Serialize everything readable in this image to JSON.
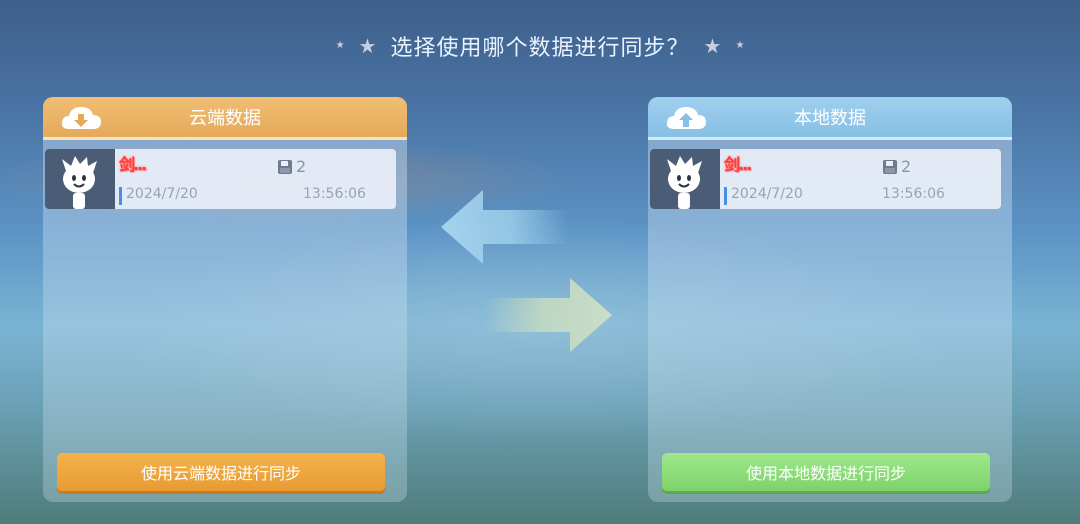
{
  "dialog": {
    "title": "选择使用哪个数据进行同步？",
    "stars": [
      "★",
      "★",
      "★",
      "★"
    ]
  },
  "cloud": {
    "header": "云端数据",
    "icon": "cloud-download-icon",
    "save": {
      "name": "剑...",
      "slot": "2",
      "date": "2024/7/20",
      "time": "13:56:06"
    },
    "button": "使用云端数据进行同步",
    "accent": "#e9a244"
  },
  "local": {
    "header": "本地数据",
    "icon": "cloud-upload-icon",
    "save": {
      "name": "剑...",
      "slot": "2",
      "date": "2024/7/20",
      "time": "13:56:06"
    },
    "button": "使用本地数据进行同步",
    "accent": "#86cf6e"
  }
}
